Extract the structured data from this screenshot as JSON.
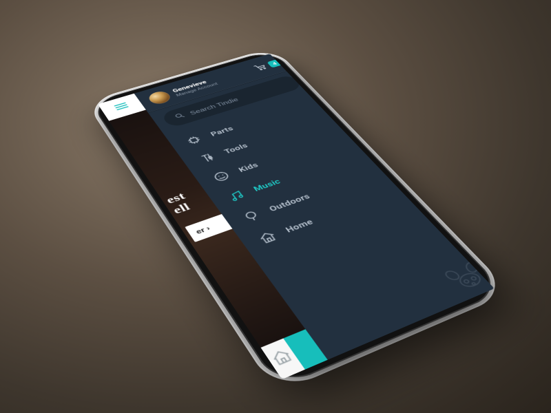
{
  "colors": {
    "accent": "#17bebb",
    "drawer_bg": "#22303f",
    "pill_bg": "#1a2530"
  },
  "cart": {
    "count": "4"
  },
  "user": {
    "name": "Genevieve",
    "subtitle": "Manage Account"
  },
  "search": {
    "placeholder": "Search Tindie"
  },
  "categories": [
    {
      "id": "parts",
      "label": "Parts",
      "icon": "chip-icon",
      "active": false
    },
    {
      "id": "tools",
      "label": "Tools",
      "icon": "tools-icon",
      "active": false
    },
    {
      "id": "kids",
      "label": "Kids",
      "icon": "smile-icon",
      "active": false
    },
    {
      "id": "music",
      "label": "Music",
      "icon": "music-icon",
      "active": true
    },
    {
      "id": "outdoors",
      "label": "Outdoors",
      "icon": "tree-icon",
      "active": false
    },
    {
      "id": "home",
      "label": "Home",
      "icon": "house-icon",
      "active": false
    }
  ],
  "hero": {
    "line1": "est",
    "line2": "ell",
    "button_fragment": "er ›"
  }
}
